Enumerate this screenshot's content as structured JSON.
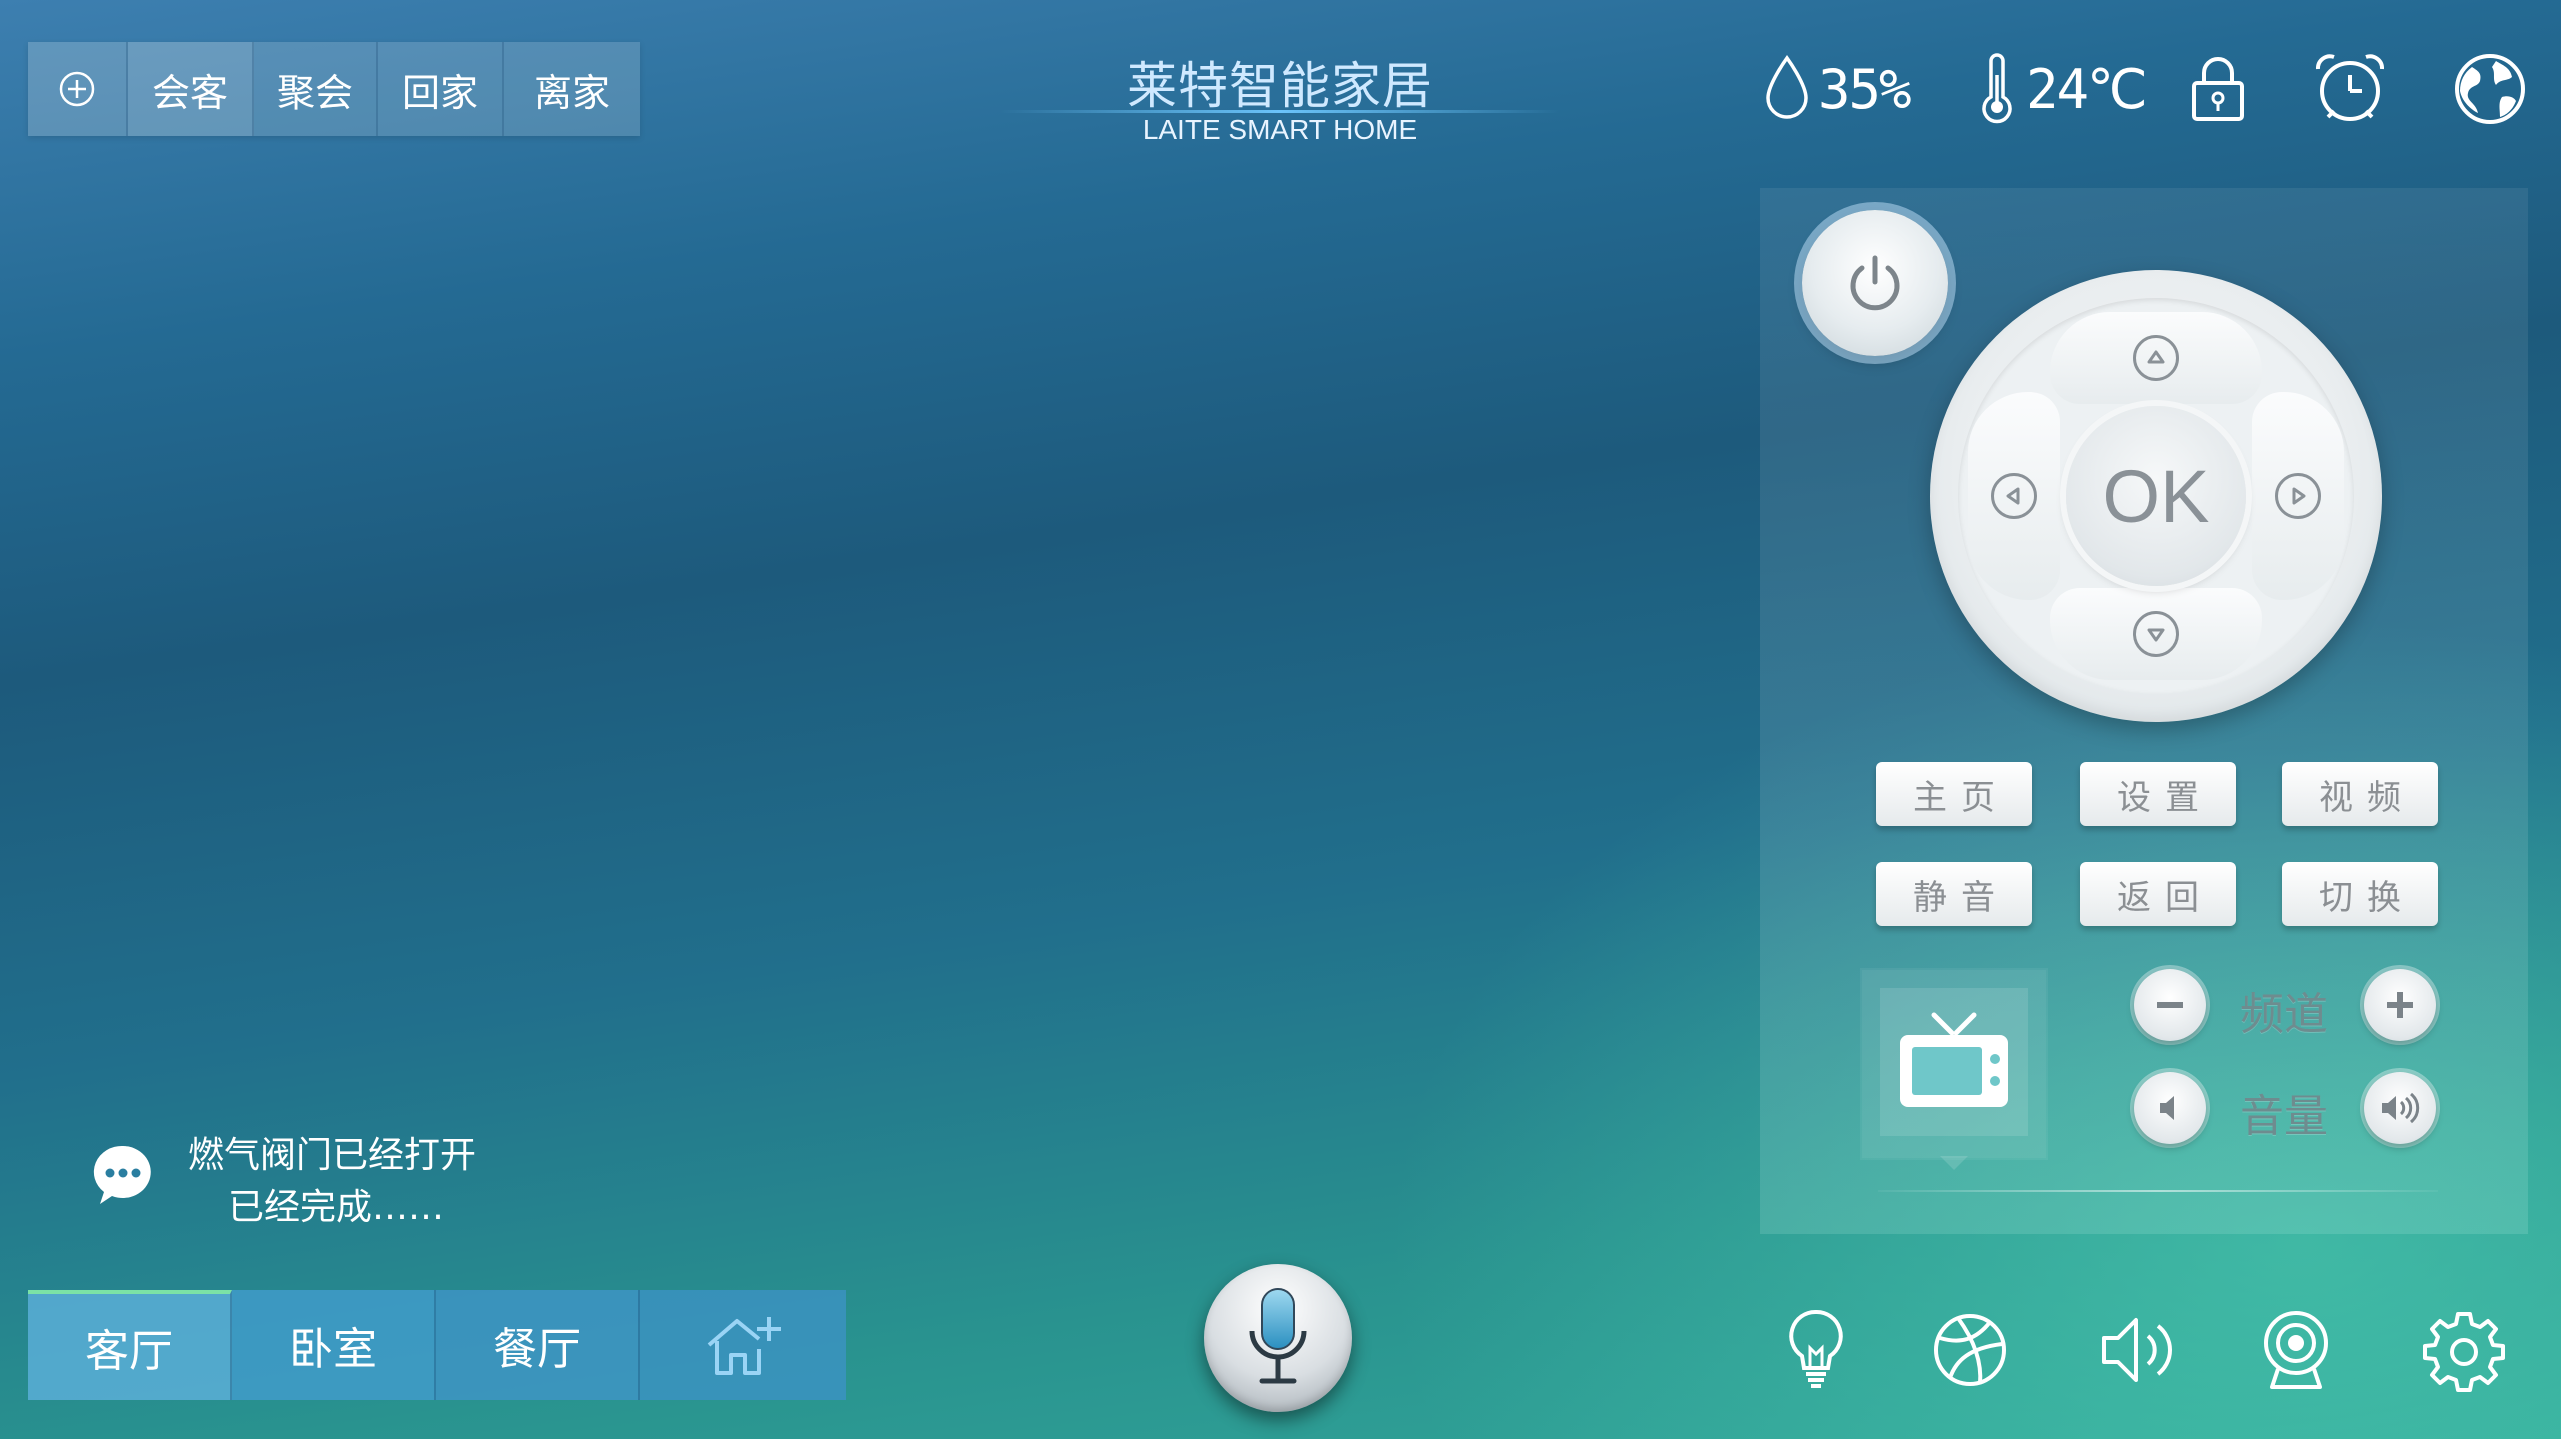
{
  "scenes": {
    "add_label": "⊕",
    "items": [
      "会客",
      "聚会",
      "回家",
      "离家"
    ]
  },
  "brand": {
    "title": "莱特智能家居",
    "subtitle": "LAITE SMART HOME"
  },
  "status": {
    "humidity": "35%",
    "temperature": "24℃",
    "icons": [
      "droplet-icon",
      "thermometer-icon",
      "lock-icon",
      "alarm-clock-icon",
      "globe-icon"
    ]
  },
  "remote": {
    "ok_label": "OK",
    "buttons_row1": [
      "主页",
      "设置",
      "视频"
    ],
    "buttons_row2": [
      "静音",
      "返回",
      "切换"
    ],
    "channel_label": "频道",
    "volume_label": "音量"
  },
  "notification": {
    "line1": "燃气阀门已经打开",
    "line2": "已经完成……"
  },
  "rooms": {
    "items": [
      "客厅",
      "卧室",
      "餐厅"
    ],
    "active": "客厅"
  },
  "bottom_icons": [
    "bulb-icon",
    "ball-icon",
    "speaker-icon",
    "camera-icon",
    "settings-icon"
  ],
  "colors": {
    "accent_green": "#7be2a6",
    "text_white": "#ffffff",
    "brand_blue": "#cfe9ff"
  }
}
